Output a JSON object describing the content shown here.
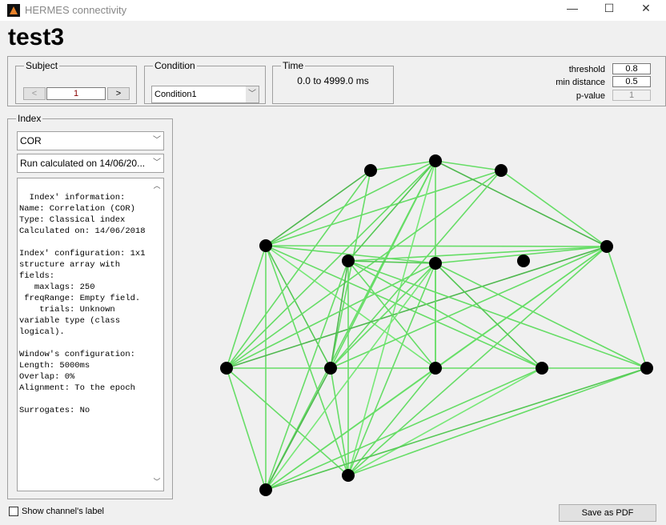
{
  "window": {
    "title": "HERMES connectivity",
    "minimize": "—",
    "maximize": "☐",
    "close": "✕"
  },
  "project_title": "test3",
  "subject": {
    "label": "Subject",
    "prev": "<",
    "value": "1",
    "next": ">"
  },
  "condition": {
    "label": "Condition",
    "selected": "Condition1"
  },
  "time": {
    "label": "Time",
    "value": "0.0 to 4999.0 ms"
  },
  "params": {
    "threshold_label": "threshold",
    "threshold": "0.8",
    "min_distance_label": "min distance",
    "min_distance": "0.5",
    "pvalue_label": "p-value",
    "pvalue": "1"
  },
  "index": {
    "label": "Index",
    "selected": "COR",
    "run": "Run calculated on 14/06/20...",
    "info": "Index' information:\nName: Correlation (COR)\nType: Classical index\nCalculated on: 14/06/2018\n\nIndex' configuration: 1x1\nstructure array with\nfields:\n   maxlags: 250\n freqRange: Empty field.\n    trials: Unknown\nvariable type (class\nlogical).\n\nWindow's configuration:\nLength: 5000ms\nOverlap: 0%\nAlignment: To the epoch\n\nSurrogates: No"
  },
  "show_label": "Show channel's label",
  "save_pdf": "Save as PDF",
  "graph": {
    "node_color": "#000000",
    "edge_color": "#66dd66",
    "node_count": 15,
    "edges": [
      [
        3,
        1
      ],
      [
        3,
        2
      ],
      [
        3,
        4
      ],
      [
        3,
        0
      ],
      [
        3,
        8
      ],
      [
        3,
        13
      ],
      [
        3,
        10
      ],
      [
        3,
        11
      ],
      [
        3,
        14
      ],
      [
        3,
        9
      ],
      [
        3,
        6
      ],
      [
        0,
        1
      ],
      [
        0,
        8
      ],
      [
        0,
        9
      ],
      [
        1,
        2
      ],
      [
        1,
        4
      ],
      [
        1,
        8
      ],
      [
        1,
        9
      ],
      [
        1,
        14
      ],
      [
        1,
        13
      ],
      [
        1,
        10
      ],
      [
        1,
        5
      ],
      [
        2,
        4
      ],
      [
        2,
        9
      ],
      [
        2,
        8
      ],
      [
        4,
        5
      ],
      [
        4,
        6
      ],
      [
        4,
        8
      ],
      [
        4,
        9
      ],
      [
        4,
        12
      ],
      [
        4,
        13
      ],
      [
        4,
        14
      ],
      [
        4,
        10
      ],
      [
        5,
        6
      ],
      [
        5,
        11
      ],
      [
        5,
        12
      ],
      [
        5,
        13
      ],
      [
        5,
        14
      ],
      [
        5,
        10
      ],
      [
        5,
        9
      ],
      [
        6,
        8
      ],
      [
        6,
        9
      ],
      [
        6,
        13
      ],
      [
        6,
        14
      ],
      [
        6,
        10
      ],
      [
        6,
        11
      ],
      [
        6,
        12
      ],
      [
        8,
        12
      ],
      [
        8,
        13
      ],
      [
        8,
        14
      ],
      [
        9,
        14
      ],
      [
        9,
        13
      ],
      [
        10,
        14
      ],
      [
        10,
        13
      ],
      [
        11,
        14
      ],
      [
        11,
        13
      ],
      [
        12,
        14
      ],
      [
        12,
        13
      ]
    ]
  }
}
